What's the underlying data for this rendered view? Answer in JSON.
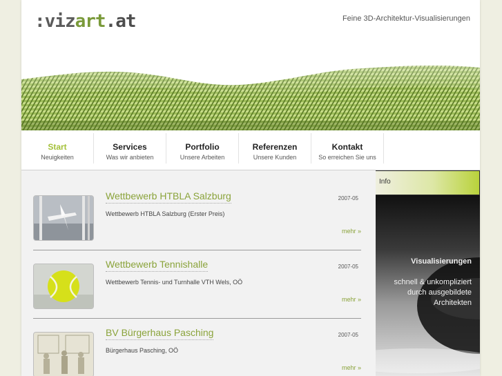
{
  "header": {
    "logo_part1": ":viz",
    "logo_part2": "art",
    "logo_part3": ".at",
    "tagline": "Feine 3D-Architektur-Visualisierungen"
  },
  "nav": [
    {
      "label": "Start",
      "sub": "Neuigkeiten"
    },
    {
      "label": "Services",
      "sub": "Was wir anbieten"
    },
    {
      "label": "Portfolio",
      "sub": "Unsere Arbeiten"
    },
    {
      "label": "Referenzen",
      "sub": "Unsere Kunden"
    },
    {
      "label": "Kontakt",
      "sub": "So erreichen Sie uns"
    }
  ],
  "articles": [
    {
      "title": "Wettbewerb HTBLA Salzburg",
      "date": "2007-05",
      "desc": "Wettbewerb HTBLA Salzburg (Erster Preis)",
      "more": "mehr »"
    },
    {
      "title": "Wettbewerb Tennishalle",
      "date": "2007-05",
      "desc": "Wettbewerb Tennis- und Turnhalle VTH Wels, OÖ",
      "more": "mehr »"
    },
    {
      "title": "BV Bürgerhaus Pasching",
      "date": "2007-05",
      "desc": "Bürgerhaus Pasching, OÖ",
      "more": "mehr »"
    }
  ],
  "sidebar": {
    "heading": "Info",
    "title": "Visualisierungen",
    "text": "schnell & unkompliziert durch ausgebildete Architekten"
  },
  "colors": {
    "accent": "#a4c13a",
    "title_green": "#8aa33a",
    "background": "#efefe2"
  }
}
